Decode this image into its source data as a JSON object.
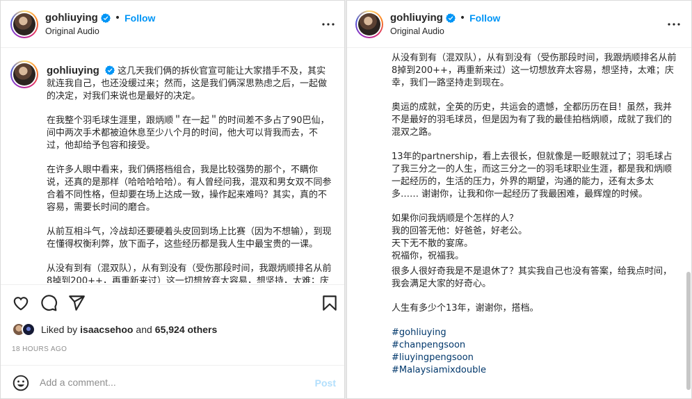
{
  "post": {
    "username": "gohliuying",
    "follow_label": "Follow",
    "audio_label": "Original Audio",
    "likes_prefix": "Liked by ",
    "likes_user": "isaacsehoo",
    "likes_and": " and ",
    "likes_count": "65,924 others",
    "time_ago": "18 HOURS AGO",
    "comment_placeholder": "Add a comment...",
    "post_label": "Post"
  },
  "caption_left": {
    "first_paragraph": "这几天我们俩的拆伙官宣可能让大家措手不及，其实就连我自己，也还没缓过来；然而，这是我们俩深思熟虑之后，一起做的决定，对我们来说也是最好的决定。",
    "paragraphs": [
      "在我整个羽毛球生涯里，跟炳顺＂在一起＂的时间差不多占了90巴仙，间中两次手术都被迫休息至少八个月的时间，他大可以背我而去，不过，他却给予包容和接受。",
      "在许多人眼中看来，我们俩搭档组合，我是比较强势的那个，不瞒你说，还真的是那样（哈哈哈哈哈）。有人曾经问我，混双和男女双不同参合着不同性格，但却要在场上达成一致，操作起来难吗？其实，真的不容易，需要长时间的磨合。",
      "从前互相斗气，冷战却还要硬着头皮回到场上比赛（因为不想输），到现在懂得权衡利弊，放下面子，这些经历都是我人生中最宝贵的一课。",
      "从没有到有（混双队），从有到没有（受伤那段时间，我跟炳顺排名从前8掉到200++，再重新来过）这一切想放弃太容易，想坚持，太难；庆幸，我们一路坚持走到现在。"
    ]
  },
  "caption_right": {
    "paragraphs": [
      "从没有到有（混双队），从有到没有（受伤那段时间，我跟炳顺排名从前8掉到200++，再重新来过）这一切想放弃太容易，想坚持，太难；庆幸，我们一路坚持走到现在。",
      "奥运的成就，全英的历史，共运会的遗憾，全都历历在目！虽然，我并不是最好的羽毛球员，但是因为有了我的最佳拍档炳顺，成就了我们的混双之路。",
      "13年的partnership，看上去很长，但就像是一眨眼就过了；羽毛球占了我三分之一的人生，而这三分之一的羽毛球职业生涯，都是我和炳顺一起经历的，生活的压力，外界的期望，沟通的能力，还有太多太多…… 谢谢你，让我和你一起经历了我最困难，最辉煌的时候。"
    ],
    "qa_lines": [
      "如果你问我炳顺是个怎样的人？",
      "我的回答无他：好爸爸，好老公。",
      "天下无不散的宴席。",
      "祝福你，祝福我。"
    ],
    "paragraphs_after": [
      "很多人很好奇我是不是退休了？其实我自己也没有答案，给我点时间，我会满足大家的好奇心。",
      "人生有多少个13年，谢谢你，搭档。"
    ],
    "hashtags": [
      "#gohliuying",
      "#chanpengsoon",
      "#liuyingpengsoon",
      "#Malaysiamixdouble"
    ]
  },
  "colors": {
    "accent": "#0095f6",
    "hashtag": "#00376b",
    "muted": "#8e8e8e",
    "post_disabled": "#b2dffc"
  }
}
